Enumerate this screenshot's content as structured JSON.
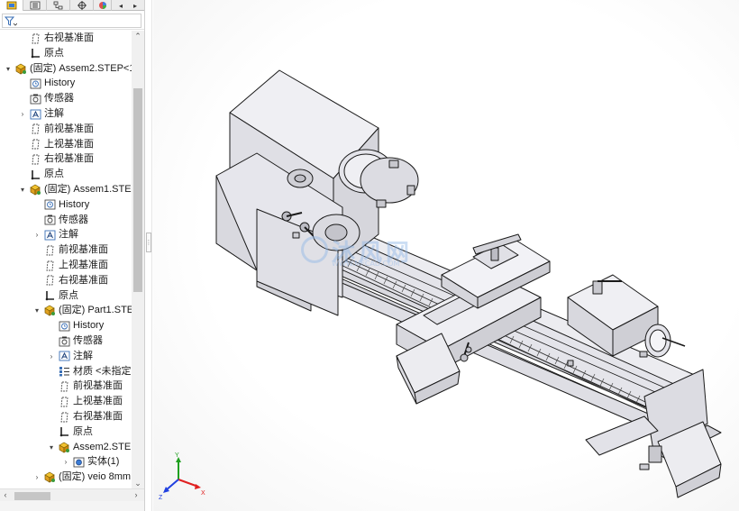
{
  "tabs": [
    {
      "icon": "feature-manager-icon",
      "active": true
    },
    {
      "icon": "property-manager-icon",
      "active": false
    },
    {
      "icon": "configuration-manager-icon",
      "active": false
    },
    {
      "icon": "dimxpert-manager-icon",
      "active": false
    },
    {
      "icon": "display-manager-icon",
      "active": false
    }
  ],
  "tree": {
    "items": [
      {
        "label": "右视基准面",
        "icon": "plane-icon",
        "depth": 1,
        "expander": ""
      },
      {
        "label": "原点",
        "icon": "origin-icon",
        "depth": 1,
        "expander": ""
      },
      {
        "label": "(固定) Assem2.STEP<1",
        "icon": "assembly-icon",
        "depth": 0,
        "expander": "▾"
      },
      {
        "label": "History",
        "icon": "history-icon",
        "depth": 1,
        "expander": ""
      },
      {
        "label": "传感器",
        "icon": "sensor-icon",
        "depth": 1,
        "expander": ""
      },
      {
        "label": "注解",
        "icon": "annotation-icon",
        "depth": 1,
        "expander": "›"
      },
      {
        "label": "前视基准面",
        "icon": "plane-icon",
        "depth": 1,
        "expander": ""
      },
      {
        "label": "上视基准面",
        "icon": "plane-icon",
        "depth": 1,
        "expander": ""
      },
      {
        "label": "右视基准面",
        "icon": "plane-icon",
        "depth": 1,
        "expander": ""
      },
      {
        "label": "原点",
        "icon": "origin-icon",
        "depth": 1,
        "expander": ""
      },
      {
        "label": "(固定) Assem1.STEP",
        "icon": "assembly-icon",
        "depth": 1,
        "expander": "▾"
      },
      {
        "label": "History",
        "icon": "history-icon",
        "depth": 2,
        "expander": ""
      },
      {
        "label": "传感器",
        "icon": "sensor-icon",
        "depth": 2,
        "expander": ""
      },
      {
        "label": "注解",
        "icon": "annotation-icon",
        "depth": 2,
        "expander": "›"
      },
      {
        "label": "前视基准面",
        "icon": "plane-icon",
        "depth": 2,
        "expander": ""
      },
      {
        "label": "上视基准面",
        "icon": "plane-icon",
        "depth": 2,
        "expander": ""
      },
      {
        "label": "右视基准面",
        "icon": "plane-icon",
        "depth": 2,
        "expander": ""
      },
      {
        "label": "原点",
        "icon": "origin-icon",
        "depth": 2,
        "expander": ""
      },
      {
        "label": "(固定) Part1.STE",
        "icon": "assembly-icon",
        "depth": 2,
        "expander": "▾"
      },
      {
        "label": "History",
        "icon": "history-icon",
        "depth": 3,
        "expander": ""
      },
      {
        "label": "传感器",
        "icon": "sensor-icon",
        "depth": 3,
        "expander": ""
      },
      {
        "label": "注解",
        "icon": "annotation-icon",
        "depth": 3,
        "expander": "›"
      },
      {
        "label": "材质 <未指定",
        "icon": "material-icon",
        "depth": 3,
        "expander": ""
      },
      {
        "label": "前视基准面",
        "icon": "plane-icon",
        "depth": 3,
        "expander": ""
      },
      {
        "label": "上视基准面",
        "icon": "plane-icon",
        "depth": 3,
        "expander": ""
      },
      {
        "label": "右视基准面",
        "icon": "plane-icon",
        "depth": 3,
        "expander": ""
      },
      {
        "label": "原点",
        "icon": "origin-icon",
        "depth": 3,
        "expander": ""
      },
      {
        "label": "Assem2.STE",
        "icon": "assembly-icon",
        "depth": 3,
        "expander": "▾"
      },
      {
        "label": "实体(1)",
        "icon": "solid-body-icon",
        "depth": 4,
        "expander": "›"
      },
      {
        "label": "(固定) veio 8mm",
        "icon": "assembly-icon",
        "depth": 2,
        "expander": "›"
      }
    ]
  },
  "watermark": {
    "title": "沐风网",
    "subtitle": "WWW.MFCAD.COM"
  },
  "triad": {
    "x": "X",
    "y": "Y",
    "z": "Z"
  },
  "colors": {
    "model_fill": "#e8e8ec",
    "model_edge": "#1a1a1a",
    "axis_x": "#e02020",
    "axis_y": "#20a020",
    "axis_z": "#2040e0"
  }
}
